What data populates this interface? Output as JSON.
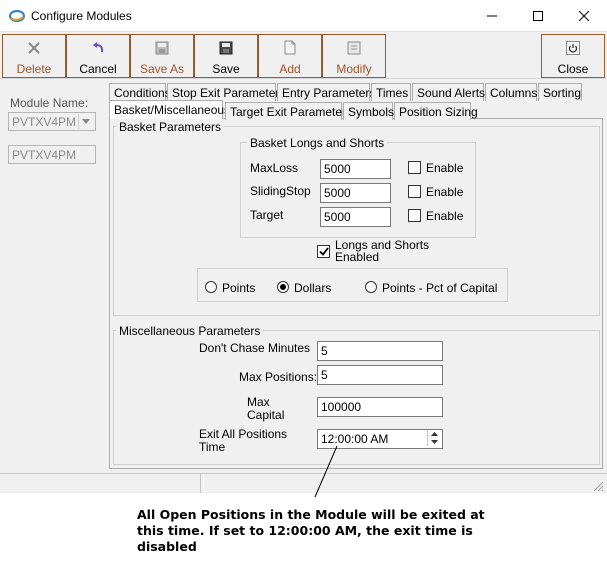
{
  "window": {
    "title": "Configure Modules"
  },
  "toolbar": {
    "delete_label": "Delete",
    "cancel_label": "Cancel",
    "save_as_label": "Save As",
    "save_label": "Save",
    "add_label": "Add",
    "modify_label": "Modify",
    "close_label": "Close"
  },
  "module": {
    "label": "Module Name:",
    "selected": "PVTXV4PM",
    "name_value": "PVTXV4PM"
  },
  "tabs": {
    "row1": [
      "Conditions",
      "Stop Exit Parameters",
      "Entry Parameters",
      "Times",
      "Sound Alerts",
      "Columns",
      "Sorting"
    ],
    "row2": [
      "Basket/Miscellaneous",
      "Target Exit Parameters",
      "Symbols",
      "Position Sizing"
    ],
    "active": "Basket/Miscellaneous"
  },
  "basket": {
    "title": "Basket Parameters",
    "longs_shorts_title": "Basket Longs and Shorts",
    "maxloss_label": "MaxLoss",
    "maxloss_value": "5000",
    "slidingstop_label": "SlidingStop",
    "slidingstop_value": "5000",
    "target_label": "Target",
    "target_value": "5000",
    "enable_label": "Enable",
    "longs_shorts_enabled_line1": "Longs and Shorts",
    "longs_shorts_enabled_line2": "Enabled",
    "units": [
      "Points",
      "Dollars",
      "Points - Pct of Capital"
    ],
    "selected_unit": "Dollars"
  },
  "misc": {
    "title": "Miscellaneous Parameters",
    "dont_chase_label": "Don't Chase Minutes",
    "dont_chase_value": "5",
    "max_positions_label": "Max Positions:",
    "max_positions_value": "5",
    "max_capital_line1": "Max",
    "max_capital_line2": "Capital",
    "max_capital_value": "100000",
    "exit_all_line1": "Exit All Positions",
    "exit_all_line2": "Time",
    "exit_all_value": "12:00:00 AM"
  },
  "annotation": {
    "line1": "All Open Positions in the Module will be exited at",
    "line2": "this time.  If set to 12:00:00 AM, the exit time is",
    "line3": "disabled"
  },
  "colors": {
    "toolbar_border": "#9b5b2b",
    "toolbar_label": "#a0522d"
  }
}
